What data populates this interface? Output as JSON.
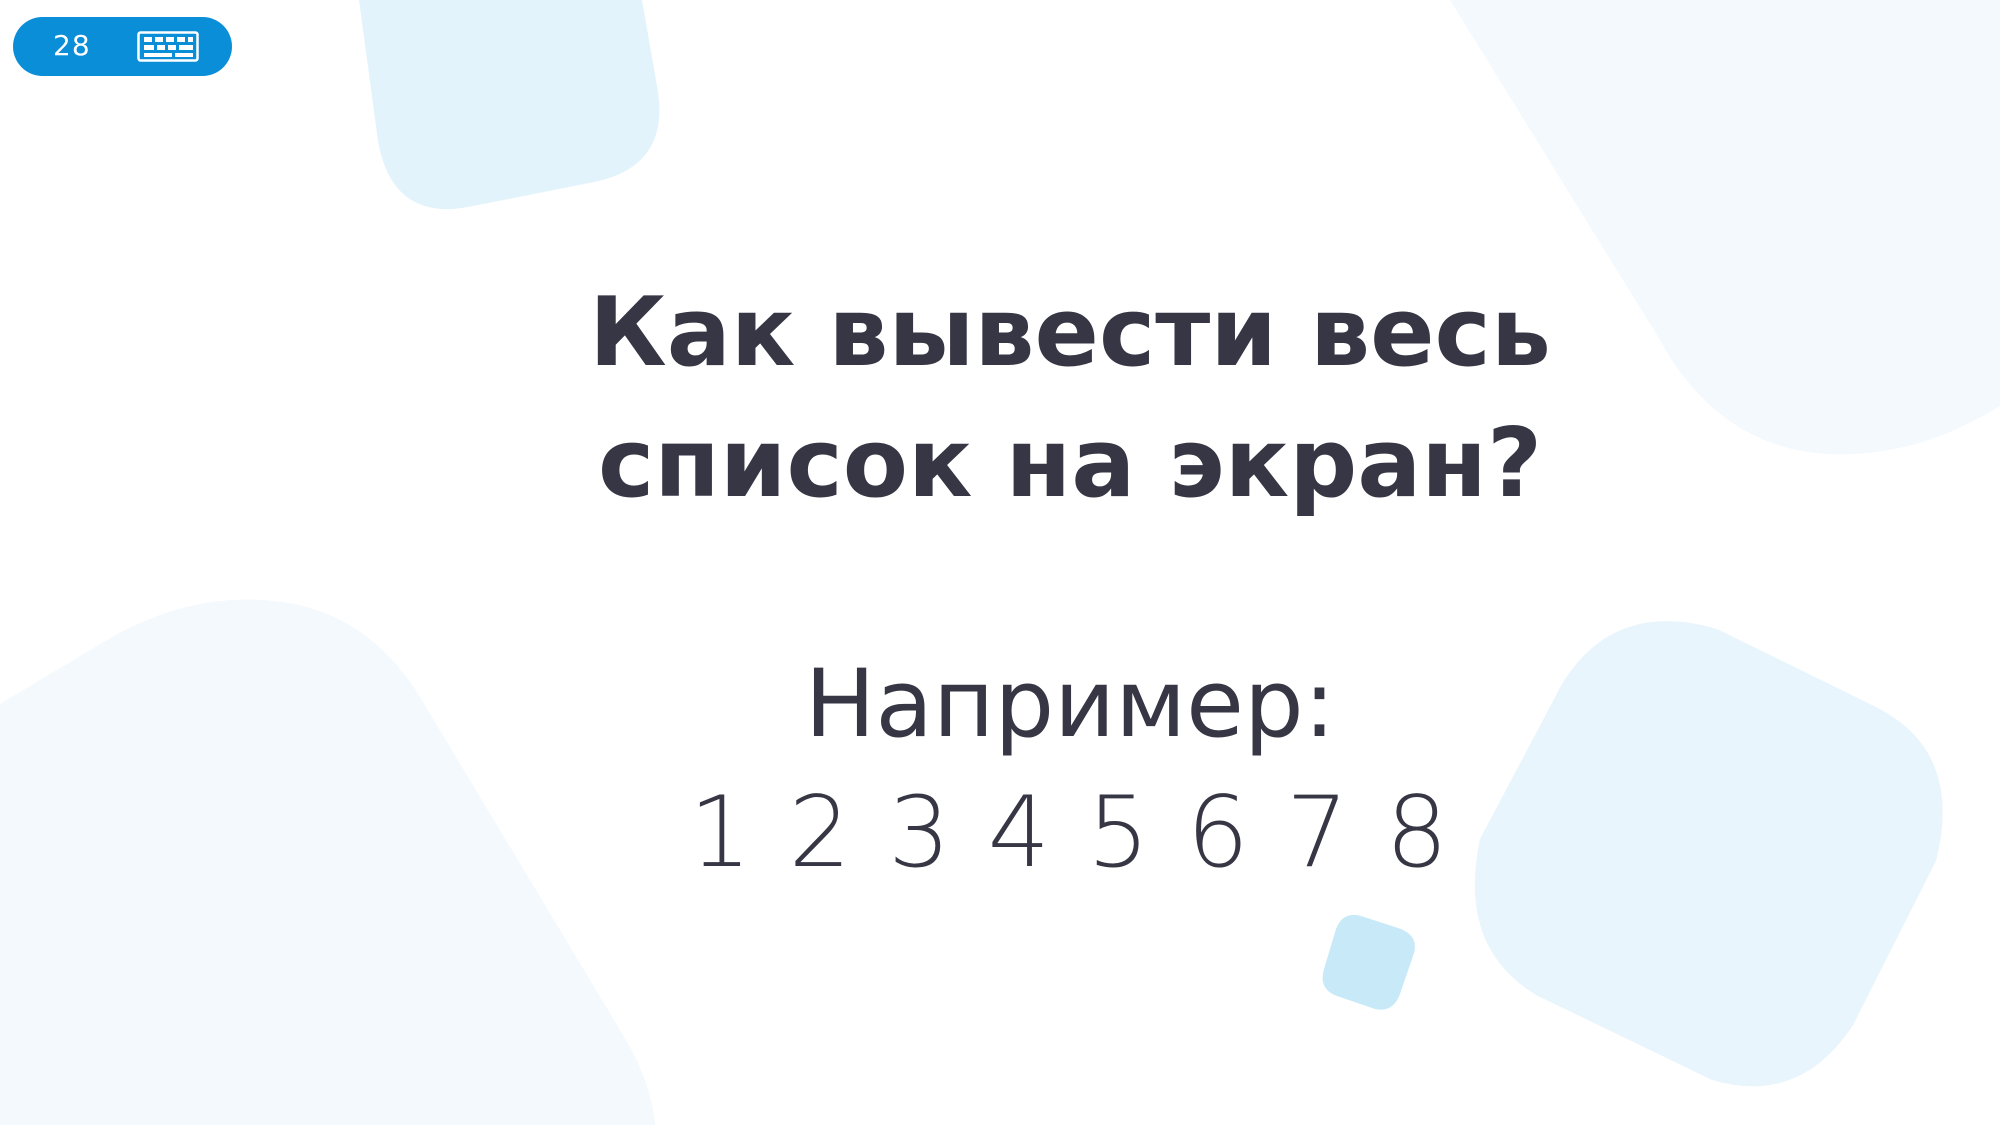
{
  "slide": {
    "number": "28",
    "badge_icon": "keyboard-icon",
    "title_line_1": "Как вывести весь",
    "title_line_2": "список на экран?",
    "example_label": "Например:",
    "example_values": "1 2 3 4 5 6 7 8"
  },
  "colors": {
    "badge": "#0b8ed8",
    "text": "#363644",
    "shape_light_blue": "#e2f3fb",
    "shape_pale_blue": "#f3f9fd",
    "shape_mid_blue": "#c8e9f8"
  }
}
